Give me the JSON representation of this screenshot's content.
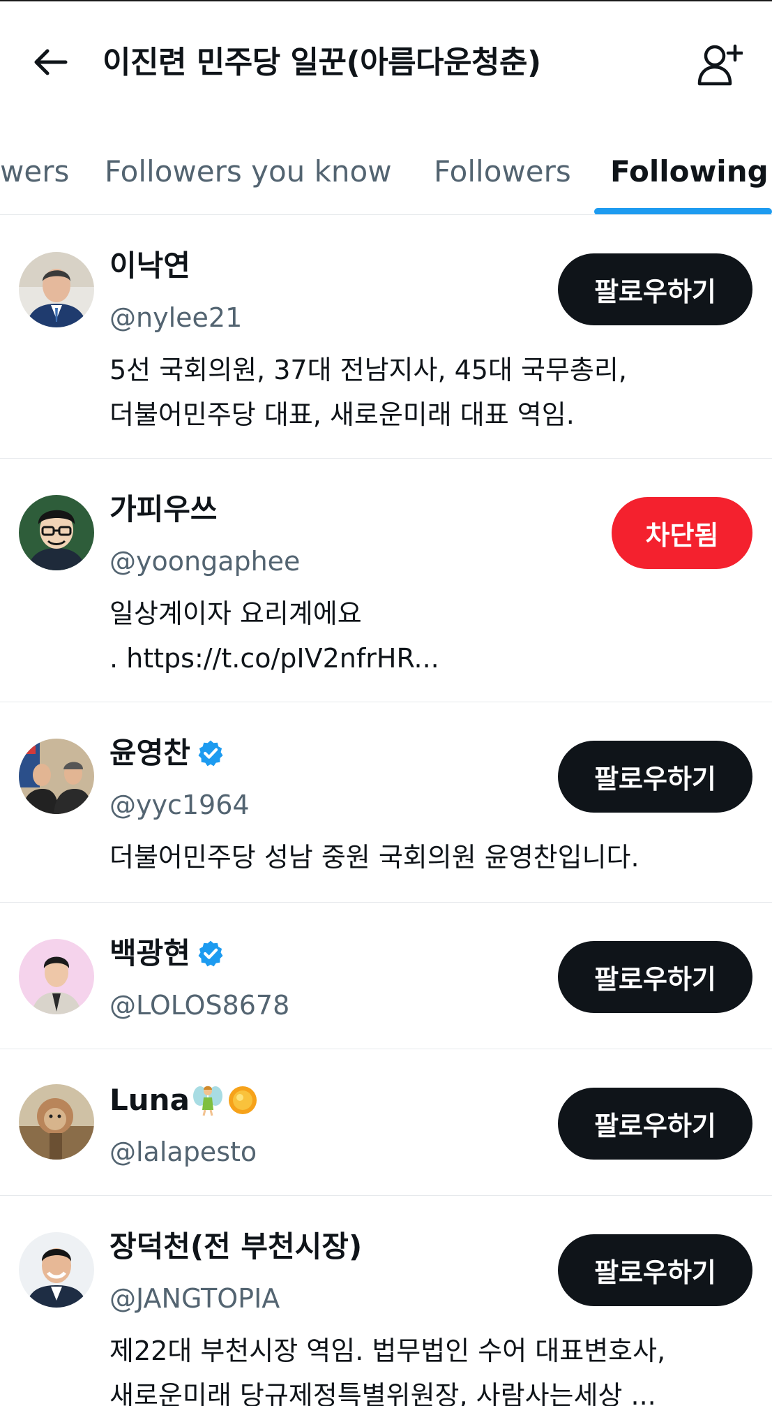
{
  "header": {
    "title": "이진련 민주당 일꾼(아름다운청춘)",
    "back_icon": "arrow-left-icon",
    "add_icon": "add-user-icon"
  },
  "tabs": [
    {
      "label": "Verified Followers",
      "visible_label": "wers"
    },
    {
      "label": "Followers you know"
    },
    {
      "label": "Followers"
    },
    {
      "label": "Following",
      "active": true
    }
  ],
  "accent_color": "#1d9bf0",
  "blocked_color": "#f4212e",
  "users": [
    {
      "name": "이낙연",
      "handle": "@nylee21",
      "verified": false,
      "button": "팔로우하기",
      "bio": [
        "5선 국회의원, 37대 전남지사, 45대 국무총리,",
        "더불어민주당 대표, 새로운미래 대표 역임."
      ]
    },
    {
      "name": "가피우쓰",
      "handle": "@yoongaphee",
      "verified": false,
      "button": "차단됨",
      "bio": [
        "일상계이자 요리계에요",
        ". https://t.co/pIV2nfrHR..."
      ]
    },
    {
      "name": "윤영찬",
      "handle": "@yyc1964",
      "verified": true,
      "button": "팔로우하기",
      "bio": [
        "더불어민주당 성남 중원 국회의원 윤영찬입니다."
      ]
    },
    {
      "name": "백광현",
      "handle": "@LOLOS8678",
      "verified": true,
      "button": "팔로우하기",
      "bio": []
    },
    {
      "name": "Luna",
      "handle": "@lalapesto",
      "verified": false,
      "emojis": [
        "fairy-emoji",
        "sun-emoji"
      ],
      "button": "팔로우하기",
      "bio": []
    },
    {
      "name": "장덕천(전 부천시장)",
      "handle": "@JANGTOPIA",
      "verified": false,
      "button": "팔로우하기",
      "bio": [
        "제22대 부천시장 역임. 법무법인 수어 대표변호사,",
        "새로운미래 당규제정특별위원장, 사람사는세상 ..."
      ]
    }
  ]
}
